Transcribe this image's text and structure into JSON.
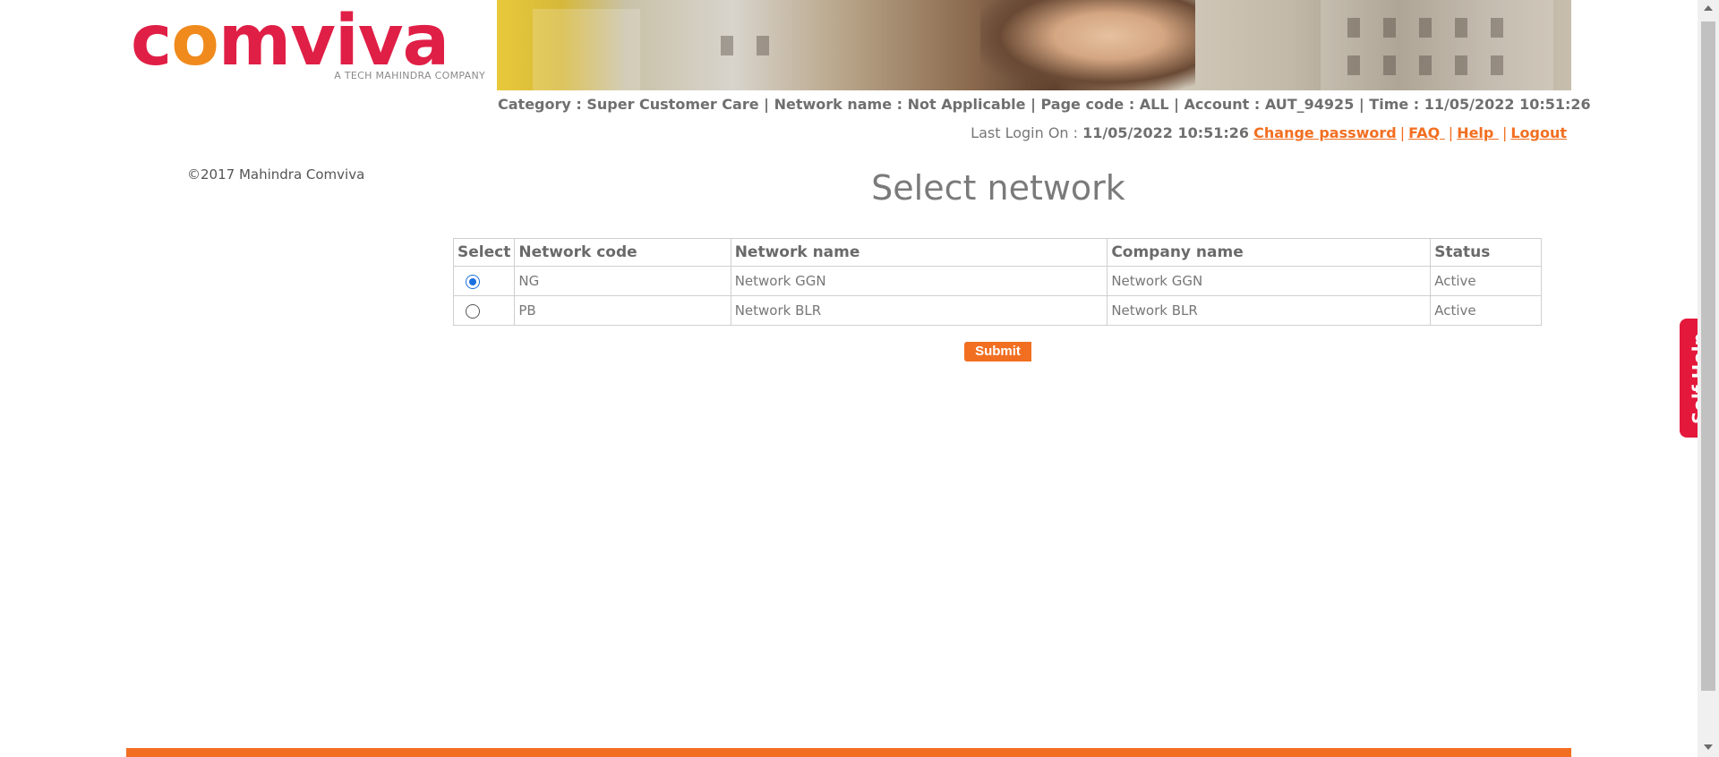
{
  "logo": {
    "wordmark_pre": "c",
    "wordmark_o": "o",
    "wordmark_post": "mviva",
    "tagline": "A TECH MAHINDRA COMPANY"
  },
  "header": {
    "info_line": "Category : Super Customer Care | Network name : Not Applicable | Page code : ALL | Account : AUT_94925 | Time : 11/05/2022 10:51:26",
    "last_login_label": "Last Login On : ",
    "last_login_value": "11/05/2022 10:51:26",
    "links": {
      "change_password": "Change password",
      "faq": "FAQ ",
      "help": "Help ",
      "logout": "Logout"
    },
    "separator": "|"
  },
  "copyright": "©2017 Mahindra Comviva",
  "page_title": "Select network",
  "table": {
    "headers": [
      "Select",
      "Network code",
      "Network name",
      "Company name",
      "Status"
    ],
    "rows": [
      {
        "code": "NG",
        "name": "Network GGN",
        "company": "Network GGN",
        "status": "Active",
        "selected": true
      },
      {
        "code": "PB",
        "name": "Network BLR",
        "company": "Network BLR",
        "status": "Active",
        "selected": false
      }
    ]
  },
  "submit_label": "Submit",
  "self_help_label": "Self Help",
  "colors": {
    "accent": "#f26f21",
    "brand_red": "#e01f46",
    "self_help": "#e3183b",
    "radio_selected": "#1a6fe0"
  }
}
